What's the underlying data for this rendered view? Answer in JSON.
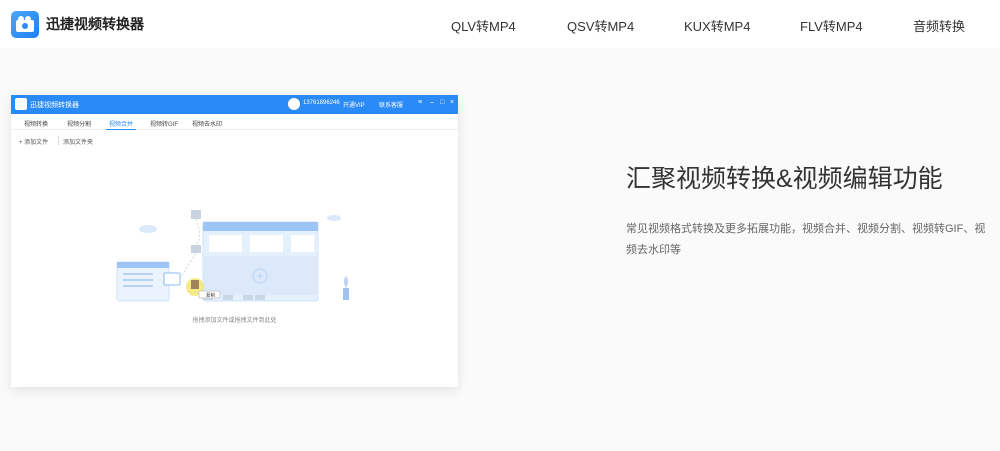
{
  "header": {
    "logo_text": "迅捷视频转换器",
    "nav": [
      "QLV转MP4",
      "QSV转MP4",
      "KUX转MP4",
      "FLV转MP4",
      "音频转换"
    ]
  },
  "app": {
    "title": "迅捷视频转换器",
    "phone": "13761896246",
    "vip": "开通VIP",
    "cs": "联系客服",
    "tabs": [
      "视频转换",
      "视频分割",
      "视频合并",
      "视频转GIF",
      "视频去水印"
    ],
    "active_tab": "视频合并",
    "toolbar": [
      "+ 添加文件",
      "添加文件夹"
    ],
    "drop_hint": "拖拽添加文件或拖拽文件到此处",
    "drag_label": "复制",
    "icons": [
      "user-icon",
      "cart-icon",
      "chat-icon",
      "menu-icon",
      "minimize-icon",
      "maximize-icon",
      "close-icon"
    ]
  },
  "feature": {
    "headline": "汇聚视频转换&视频编辑功能",
    "description": "常见视频格式转换及更多拓展功能，视频合并、视频分割、视频转GIF、视频去水印等"
  },
  "colors": {
    "accent": "#2a8af6",
    "headline": "#333333",
    "body": "#666666"
  }
}
